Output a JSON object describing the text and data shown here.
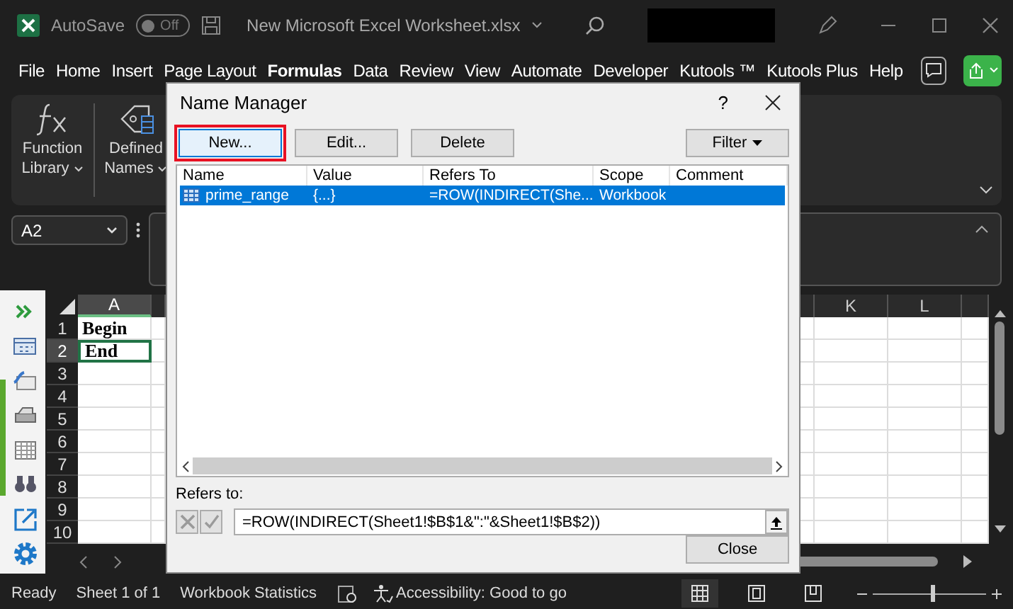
{
  "title_bar": {
    "autosave_label": "AutoSave",
    "autosave_toggle": {
      "label": "Off",
      "on": false
    },
    "file_name": "New Microsoft Excel Worksheet.xlsx"
  },
  "menu": [
    {
      "label": "File",
      "selected": false
    },
    {
      "label": "Home",
      "selected": false
    },
    {
      "label": "Insert",
      "selected": false
    },
    {
      "label": "Page Layout",
      "selected": false
    },
    {
      "label": "Formulas",
      "selected": true
    },
    {
      "label": "Data",
      "selected": false
    },
    {
      "label": "Review",
      "selected": false
    },
    {
      "label": "View",
      "selected": false
    },
    {
      "label": "Automate",
      "selected": false
    },
    {
      "label": "Developer",
      "selected": false
    },
    {
      "label": "Kutools ™",
      "selected": false
    },
    {
      "label": "Kutools Plus",
      "selected": false
    },
    {
      "label": "Help",
      "selected": false
    }
  ],
  "ribbon_groups": [
    {
      "kind": "function",
      "lines": [
        "Function",
        "Library"
      ]
    },
    {
      "kind": "names",
      "lines": [
        "Defined",
        "Names"
      ]
    }
  ],
  "name_box": "A2",
  "sheet": {
    "columns": [
      {
        "label": "A",
        "selected": true
      },
      {
        "label": "K",
        "selected": false
      },
      {
        "label": "L",
        "selected": false
      }
    ],
    "rows": [
      {
        "number": "1",
        "selected": false,
        "cell": "Begin"
      },
      {
        "number": "2",
        "selected": true,
        "cell": "End"
      },
      {
        "number": "3",
        "selected": false
      },
      {
        "number": "4",
        "selected": false
      },
      {
        "number": "5",
        "selected": false
      },
      {
        "number": "6",
        "selected": false
      },
      {
        "number": "7",
        "selected": false
      },
      {
        "number": "8",
        "selected": false
      },
      {
        "number": "9",
        "selected": false
      },
      {
        "number": "10",
        "selected": false
      }
    ]
  },
  "status_bar": {
    "ready": "Ready",
    "sheet": "Sheet 1 of 1",
    "statistics": "Workbook Statistics",
    "accessibility": "Accessibility: Good to go",
    "zoom_slider": {
      "level": 0.52
    }
  },
  "dialog": {
    "title": "Name Manager",
    "help": "?",
    "buttons": [
      {
        "label": "New...",
        "highlighted": true,
        "dropdown": false
      },
      {
        "label": "Edit...",
        "highlighted": false,
        "dropdown": false
      },
      {
        "label": "Delete",
        "highlighted": false,
        "dropdown": false
      },
      {
        "label": "Filter",
        "highlighted": false,
        "dropdown": true
      }
    ],
    "columns": [
      "Name",
      "Value",
      "Refers To",
      "Scope",
      "Comment"
    ],
    "names": [
      {
        "name": "prime_range",
        "value": "{...}",
        "refers_to": "=ROW(INDIRECT(She...",
        "scope": "Workbook",
        "selected": true
      }
    ],
    "refers_label": "Refers to:",
    "refers_buttons": [
      {
        "kind": "cancel",
        "disabled": true
      },
      {
        "kind": "confirm",
        "disabled": true
      }
    ],
    "refers_value": "=ROW(INDIRECT(Sheet1!$B$1&\":\"&Sheet1!$B$2))",
    "close": "Close"
  }
}
